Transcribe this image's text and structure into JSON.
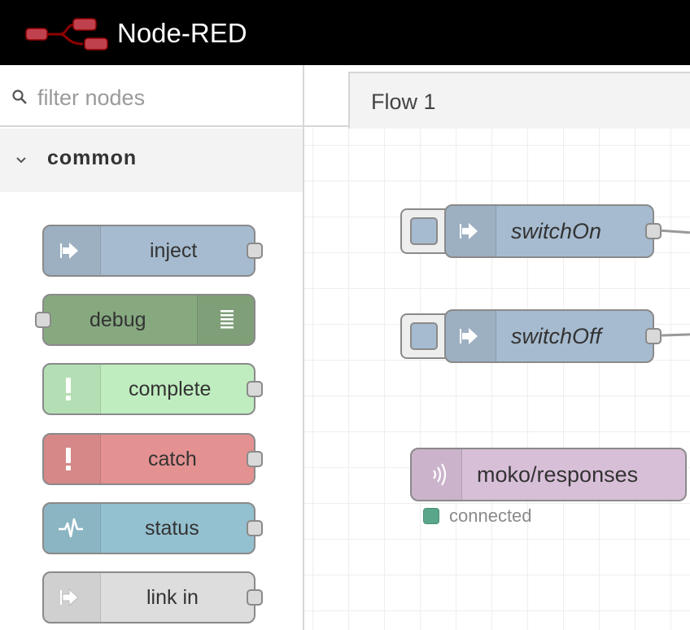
{
  "app": {
    "title": "Node-RED"
  },
  "palette": {
    "filter_placeholder": "filter nodes",
    "category": "common",
    "nodes": [
      {
        "label": "inject",
        "color": "#a6bbcf",
        "icon": "arrow-in-icon"
      },
      {
        "label": "debug",
        "color": "#87a980",
        "icon": "list-icon"
      },
      {
        "label": "complete",
        "color": "#c0edc0",
        "icon": "exclamation-icon"
      },
      {
        "label": "catch",
        "color": "#e49191",
        "icon": "exclamation-icon"
      },
      {
        "label": "status",
        "color": "#94c1d0",
        "icon": "pulse-icon"
      },
      {
        "label": "link in",
        "color": "#dddddd",
        "icon": "link-icon"
      }
    ]
  },
  "workspace": {
    "tab": "Flow 1",
    "nodes": [
      {
        "label": "switchOn",
        "color": "#a6bbcf",
        "icon": "arrow-in-icon"
      },
      {
        "label": "switchOff",
        "color": "#a6bbcf",
        "icon": "arrow-in-icon"
      },
      {
        "label": "moko/responses",
        "color": "#d8bfd8",
        "icon": "mqtt-wave-icon",
        "status": "connected",
        "status_color": "#5aa68a"
      }
    ]
  }
}
